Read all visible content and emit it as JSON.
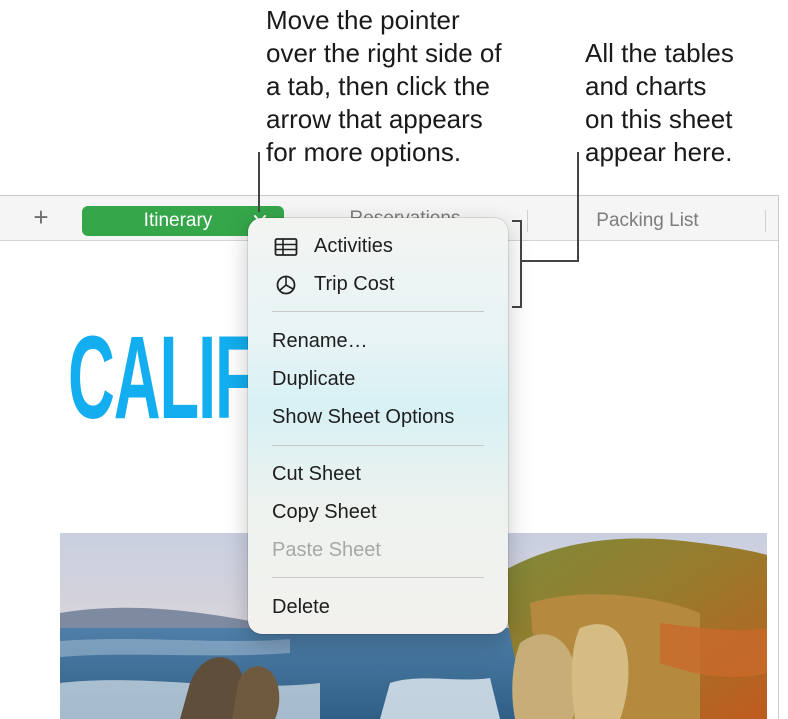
{
  "callouts": {
    "tab_options": [
      "Move the pointer",
      "over the right side of",
      "a tab, then click the",
      "arrow that appears",
      "for more options."
    ],
    "tables_charts": [
      "All the tables",
      "and charts",
      "on this sheet",
      "appear here."
    ]
  },
  "tabbar": {
    "add_icon": "+",
    "tabs": [
      {
        "label": "Itinerary",
        "active": true
      },
      {
        "label": "Reservations",
        "active": false
      },
      {
        "label": "Packing List",
        "active": false
      }
    ],
    "active_color": "#35a64a"
  },
  "sheet": {
    "title": "CALIFORNIA",
    "title_color": "#13aef0"
  },
  "context_menu": {
    "objects": [
      {
        "label": "Activities",
        "icon": "table-icon"
      },
      {
        "label": "Trip Cost",
        "icon": "pie-chart-icon"
      }
    ],
    "sheet_actions": [
      {
        "label": "Rename…",
        "enabled": true
      },
      {
        "label": "Duplicate",
        "enabled": true
      },
      {
        "label": "Show Sheet Options",
        "enabled": true
      }
    ],
    "clipboard_actions": [
      {
        "label": "Cut Sheet",
        "enabled": true
      },
      {
        "label": "Copy Sheet",
        "enabled": true
      },
      {
        "label": "Paste Sheet",
        "enabled": false
      }
    ],
    "destructive_actions": [
      {
        "label": "Delete",
        "enabled": true
      }
    ]
  }
}
